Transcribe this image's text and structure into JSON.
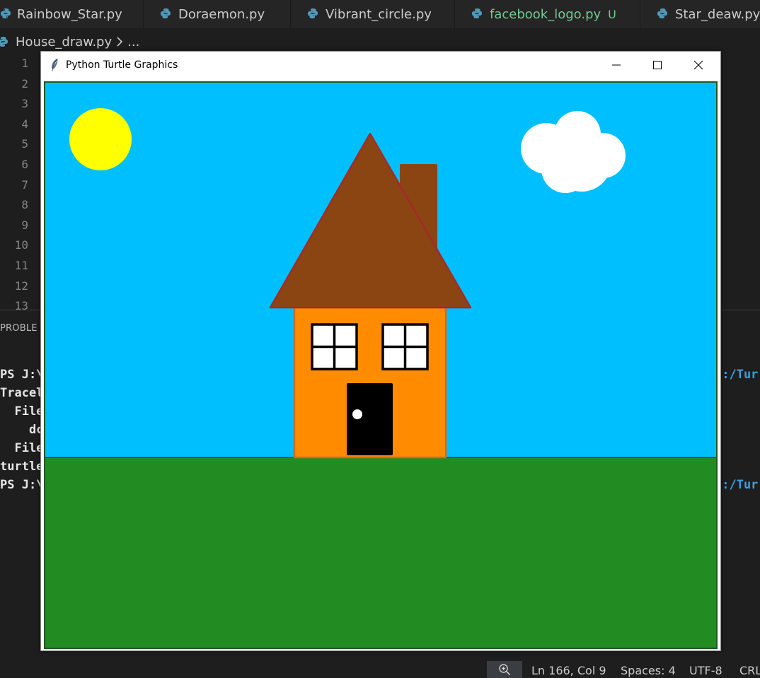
{
  "tabs": [
    {
      "label": "Rainbow_Star.py",
      "icon": "python-file-icon"
    },
    {
      "label": "Doraemon.py",
      "icon": "python-file-icon"
    },
    {
      "label": "Vibrant_circle.py",
      "icon": "python-file-icon"
    },
    {
      "label": "facebook_logo.py",
      "icon": "python-file-icon",
      "badge": "U"
    },
    {
      "label": "Star_deaw.py",
      "icon": "python-file-icon"
    }
  ],
  "breadcrumb": {
    "file": "House_draw.py",
    "rest": "..."
  },
  "gutter": {
    "lines": [
      "1",
      "2",
      "3",
      "4",
      "5",
      "6",
      "7",
      "8",
      "9",
      "10",
      "11",
      "12",
      "13"
    ]
  },
  "panel": {
    "tab_label": "PROBLE",
    "terminal_lines": [
      "PS J:\\",
      "Tracel",
      "  File",
      "    dc",
      "  File",
      "turtle",
      "PS J:\\"
    ],
    "terminal_right": [
      "j:/Tur",
      "j:/Tur"
    ]
  },
  "statusbar": {
    "zoom_icon": "zoom-in-icon",
    "position": "Ln 166, Col 9",
    "spaces": "Spaces: 4",
    "encoding": "UTF-8",
    "eol": "CRL"
  },
  "turtle_window": {
    "title": "Python Turtle Graphics",
    "icon": "feather-icon",
    "controls": [
      "minimize-icon",
      "maximize-icon",
      "close-icon"
    ],
    "colors": {
      "sky": "#00bfff",
      "grass": "#228b22",
      "sun": "#ffff00",
      "cloud": "#ffffff",
      "roof": "#8b4513",
      "roof_outline": "#a52a2a",
      "chimney": "#8b4513",
      "walls": "#ff8c00",
      "wall_outline": "#d2691e",
      "window": "#ffffff",
      "door": "#000000",
      "knob": "#ffffff"
    }
  }
}
